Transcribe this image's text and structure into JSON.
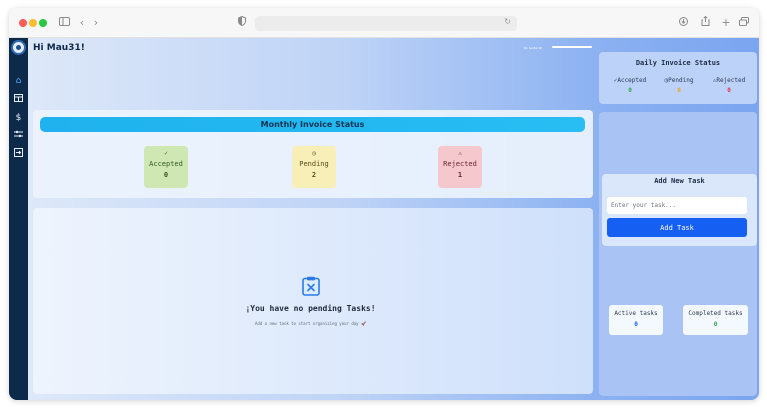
{
  "greeting": "Hi Mau31!",
  "topbar_text": "Ro Sa Ba 90",
  "sidebar": {
    "items": [
      {
        "icon": "home-icon",
        "active": true
      },
      {
        "icon": "table-icon",
        "active": false
      },
      {
        "icon": "invoice-icon",
        "active": false
      },
      {
        "icon": "settings-icon",
        "active": false
      },
      {
        "icon": "logout-icon",
        "active": false
      }
    ]
  },
  "monthly": {
    "title": "Monthly Invoice Status",
    "accepted": {
      "symbol": "✓",
      "label": "Accepted",
      "count": "0"
    },
    "pending": {
      "symbol": "◷",
      "label": "Pending",
      "count": "2"
    },
    "rejected": {
      "symbol": "⚠",
      "label": "Rejected",
      "count": "1"
    }
  },
  "tasks": {
    "empty_title": "¡You have no pending Tasks!",
    "empty_subtitle": "Add a new task to start organizing your day 🚀"
  },
  "daily": {
    "title": "Daily Invoice Status",
    "accepted": {
      "label": "✓Accepted",
      "count": "0"
    },
    "pending": {
      "label": "◷Pending",
      "count": "0"
    },
    "rejected": {
      "label": "⚠Rejected",
      "count": "0"
    }
  },
  "add_task": {
    "title": "Add New Task",
    "placeholder": "Enter your task...",
    "button": "Add Task"
  },
  "counters": {
    "active_label": "Active tasks",
    "active_count": "0",
    "completed_label": "Completed tasks",
    "completed_count": "0"
  },
  "colors": {
    "accent": "#1560f2",
    "accepted": "#2fa84f",
    "pending": "#e7a51b",
    "rejected": "#e0344b",
    "sidebar": "#0d2a4a"
  }
}
